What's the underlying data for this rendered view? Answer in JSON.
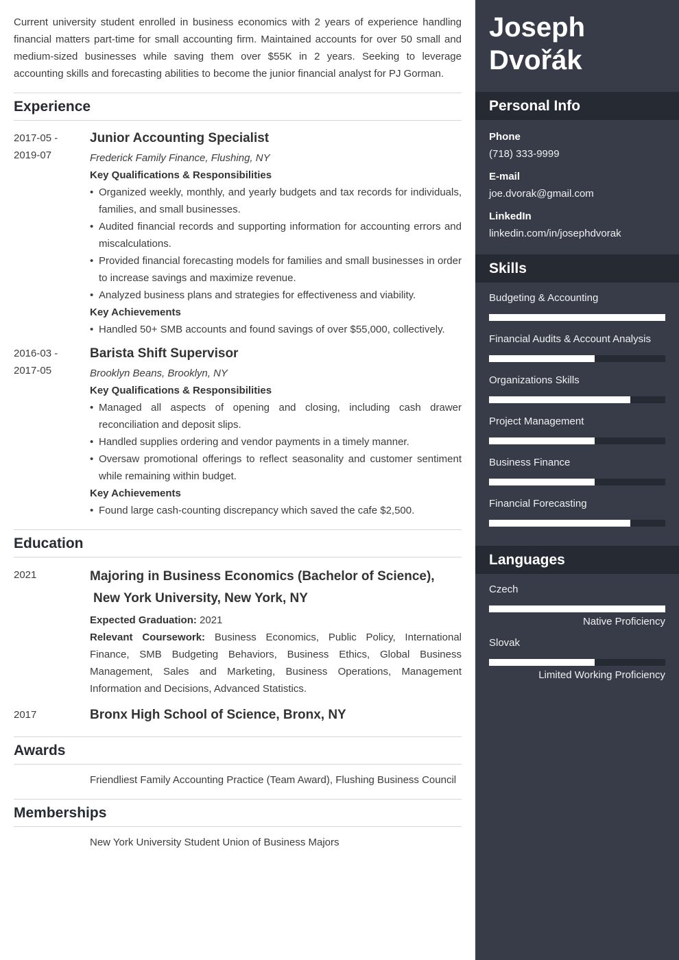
{
  "summary": "Current university student enrolled in business economics with 2 years of experience handling financial matters part-time for small accounting firm. Maintained accounts for over 50 small and medium-sized businesses while saving them over $55K in 2 years. Seeking to leverage accounting skills and forecasting abilities to become the junior financial analyst for PJ Gorman.",
  "experience": {
    "title": "Experience",
    "jobs": [
      {
        "date_start": "2017-05 -",
        "date_end": "2019-07",
        "title": "Junior Accounting Specialist",
        "company": "Frederick Family Finance, Flushing, NY",
        "resp_heading": "Key Qualifications & Responsibilities",
        "responsibilities": [
          "Organized weekly, monthly, and yearly budgets and tax records for individuals, families, and small businesses.",
          "Audited financial records and supporting information for accounting errors and miscalculations.",
          "Provided financial forecasting models for families and small businesses in order to increase savings and maximize revenue.",
          "Analyzed business plans and strategies for effectiveness and viability."
        ],
        "ach_heading": "Key Achievements",
        "achievements": [
          "Handled 50+ SMB accounts and found savings of over $55,000, collectively."
        ]
      },
      {
        "date_start": "2016-03 -",
        "date_end": "2017-05",
        "title": "Barista Shift Supervisor",
        "company": "Brooklyn Beans, Brooklyn, NY",
        "resp_heading": "Key Qualifications & Responsibilities",
        "responsibilities": [
          "Managed all aspects of opening and closing, including cash drawer reconciliation and deposit slips.",
          "Handled supplies ordering and vendor payments in a timely manner.",
          "Oversaw promotional offerings to reflect seasonality and customer sentiment while remaining within budget."
        ],
        "ach_heading": "Key Achievements",
        "achievements": [
          "Found large cash-counting discrepancy which saved the cafe $2,500."
        ]
      }
    ]
  },
  "education": {
    "title": "Education",
    "items": [
      {
        "date": "2021",
        "title_line1": "Majoring in Business Economics (Bachelor of Science),",
        "title_line2": "New York University, New York, NY",
        "grad_label": "Expected Graduation:",
        "grad_value": "2021",
        "course_label": "Relevant Coursework:",
        "course_value": "Business Economics, Public Policy, International Finance, SMB Budgeting Behaviors, Business Ethics, Global Business Management, Sales and Marketing, Business Operations, Management Information and Decisions, Advanced Statistics."
      },
      {
        "date": "2017",
        "title_line1": "Bronx High School of Science, Bronx, NY"
      }
    ]
  },
  "awards": {
    "title": "Awards",
    "items": [
      "Friendliest Family Accounting Practice (Team Award), Flushing Business Council"
    ]
  },
  "memberships": {
    "title": "Memberships",
    "items": [
      "New York University Student Union of Business Majors"
    ]
  },
  "sidebar": {
    "first_name": "Joseph",
    "last_name": "Dvořák",
    "personal_info": {
      "title": "Personal Info",
      "fields": [
        {
          "label": "Phone",
          "value": "(718) 333-9999"
        },
        {
          "label": "E-mail",
          "value": "joe.dvorak@gmail.com"
        },
        {
          "label": "LinkedIn",
          "value": "linkedin.com/in/josephdvorak"
        }
      ]
    },
    "skills": {
      "title": "Skills",
      "items": [
        {
          "name": "Budgeting & Accounting",
          "level": 100
        },
        {
          "name": "Financial Audits & Account Analysis",
          "level": 60
        },
        {
          "name": "Organizations Skills",
          "level": 80
        },
        {
          "name": "Project Management",
          "level": 60
        },
        {
          "name": "Business Finance",
          "level": 60
        },
        {
          "name": "Financial Forecasting",
          "level": 80
        }
      ]
    },
    "languages": {
      "title": "Languages",
      "items": [
        {
          "name": "Czech",
          "level": 100,
          "proficiency": "Native Proficiency"
        },
        {
          "name": "Slovak",
          "level": 60,
          "proficiency": "Limited Working Proficiency"
        }
      ]
    }
  },
  "colors": {
    "sidebar_bg": "#373c48",
    "sidebar_header_bg": "#262a33",
    "bar_fill": "#ffffff",
    "bar_track": "#262a33"
  }
}
